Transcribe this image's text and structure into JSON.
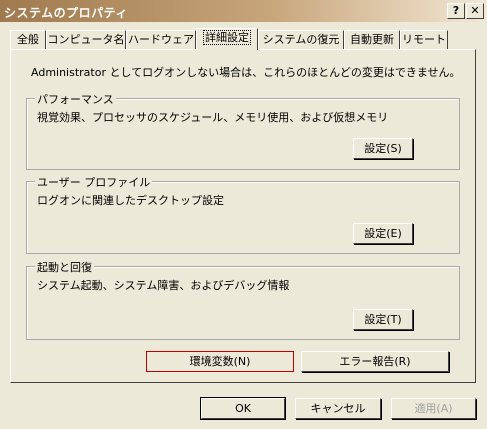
{
  "window": {
    "title": "システムのプロパティ",
    "help_label": "?",
    "close_label": "✕"
  },
  "tabs": [
    {
      "label": "全般"
    },
    {
      "label": "コンピュータ名"
    },
    {
      "label": "ハードウェア"
    },
    {
      "label": "詳細設定"
    },
    {
      "label": "システムの復元"
    },
    {
      "label": "自動更新"
    },
    {
      "label": "リモート"
    }
  ],
  "active_tab": "詳細設定",
  "notice": "Administrator としてログオンしない場合は、これらのほとんどの変更はできません。",
  "groups": {
    "performance": {
      "label": "パフォーマンス",
      "description": "視覚効果、プロセッサのスケジュール、メモリ使用、および仮想メモリ",
      "button": "設定(S)"
    },
    "user_profile": {
      "label": "ユーザー プロファイル",
      "description": "ログオンに関連したデスクトップ設定",
      "button": "設定(E)"
    },
    "startup_recovery": {
      "label": "起動と回復",
      "description": "システム起動、システム障害、およびデバッグ情報",
      "button": "設定(T)"
    }
  },
  "env_button": "環境変数(N)",
  "error_report_button": "エラー報告(R)",
  "footer": {
    "ok": "OK",
    "cancel": "キャンセル",
    "apply": "適用(A)"
  },
  "colors": {
    "title_gradient_start": "#a07a4e",
    "highlight_border": "#c00000",
    "dialog_face": "#ece9d8"
  }
}
